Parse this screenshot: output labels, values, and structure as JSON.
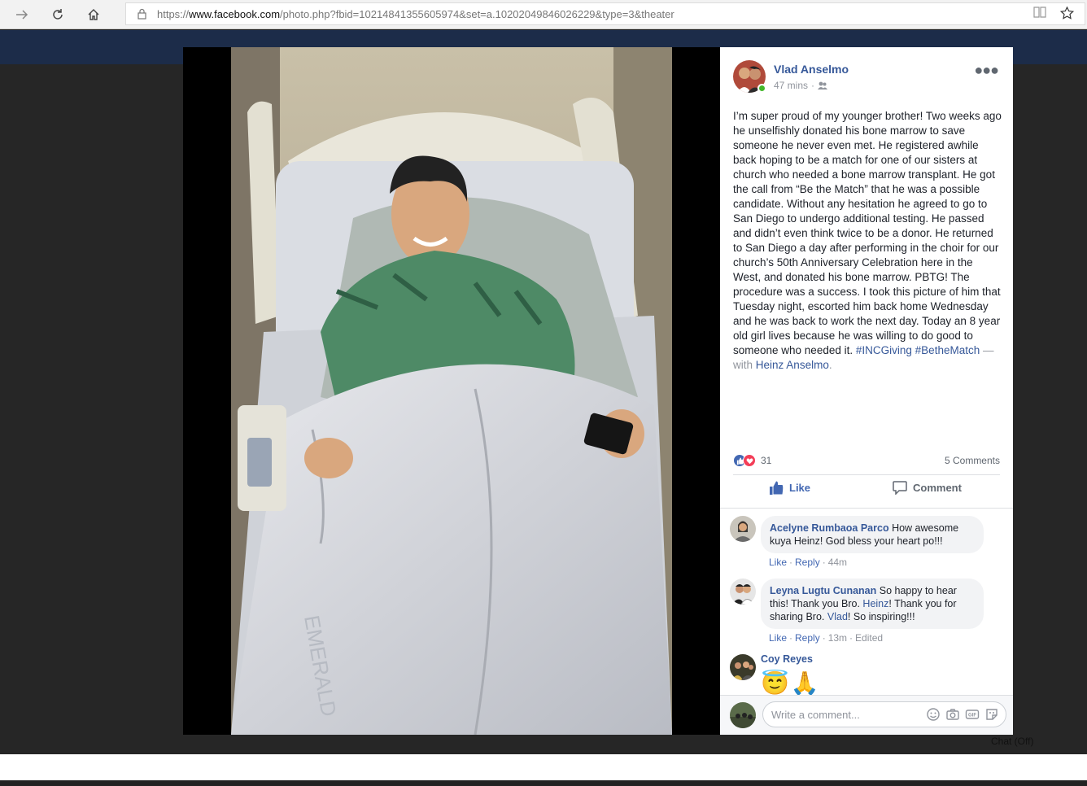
{
  "browser": {
    "url_prefix": "https://",
    "url_domain": "www.facebook.com",
    "url_path": "/photo.php?fbid=10214841355605974&set=a.10202049846026229&type=3&theater"
  },
  "post": {
    "author": "Vlad Anselmo",
    "time": "47 mins",
    "audience_icon": "friends-icon",
    "body": "I’m super proud of my younger brother! Two weeks ago he unselfishly donated his bone marrow to save someone he never even met. He registered awhile back hoping to be a match for one of our sisters at church who needed a bone marrow transplant. He got the call from “Be the Match” that he was a possible candidate. Without any hesitation he agreed to go to San Diego to undergo additional testing. He passed and didn’t even think twice to be a donor. He returned to San Diego a day after performing in the choir for our church’s 50th Anniversary Celebration here in the West, and donated his bone marrow. PBTG! The procedure was a success. I took this picture of him that Tuesday night, escorted him back home Wednesday and he was back to work the next day. Today an 8 year old girl lives because he was willing to do good to someone who needed it.",
    "hashtag1": "#INCGiving",
    "hashtag2": "#BetheMatch",
    "with_text": "— with",
    "tagged": "Heinz Anselmo",
    "tagged_end": "."
  },
  "stats": {
    "reaction_count": "31",
    "comments": "5 Comments"
  },
  "actions": {
    "like": "Like",
    "comment": "Comment"
  },
  "comments": [
    {
      "name": "Acelyne Rumbaoa Parco",
      "text": "How awesome kuya Heinz! God bless your heart po!!!",
      "like": "Like",
      "reply": "Reply",
      "time": "44m"
    },
    {
      "name": "Leyna Lugtu Cunanan",
      "text_a": "So happy to hear this! Thank you Bro.",
      "mention1": "Heinz",
      "text_b": "! Thank you for sharing Bro.",
      "mention2": "Vlad",
      "text_c": "! So inspiring!!!",
      "like": "Like",
      "reply": "Reply",
      "time": "13m",
      "edited": "Edited"
    },
    {
      "name": "Coy Reyes",
      "emoji1": "😇",
      "emoji2": "🙏"
    }
  ],
  "composer": {
    "placeholder": "Write a comment..."
  },
  "chat": {
    "label": "Chat (Off)"
  },
  "colors": {
    "fb_link": "#365899",
    "fb_blue": "#4267b2",
    "online": "#42b72a"
  }
}
